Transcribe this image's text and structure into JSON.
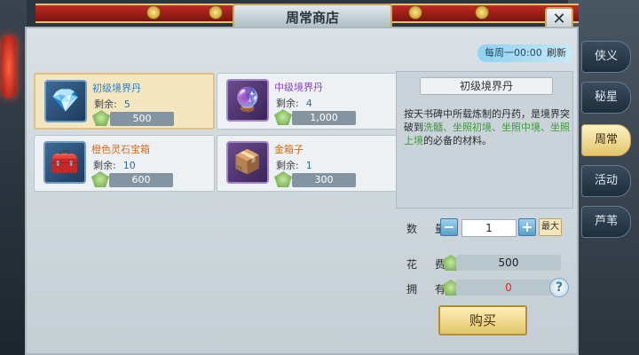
{
  "window": {
    "title": "周常商店",
    "close_symbol": "✕"
  },
  "refresh": {
    "time": "每周一00:00",
    "label": "刷新"
  },
  "items": [
    {
      "name": "初级境界丹",
      "remain_label": "剩余:",
      "remain": "5",
      "price": "500",
      "icon": "pink-pill-icon",
      "selected": true
    },
    {
      "name": "中级境界丹",
      "remain_label": "剩余:",
      "remain": "4",
      "price": "1,000",
      "icon": "purple-pill-icon",
      "selected": false
    },
    {
      "name": "橙色灵石宝箱",
      "remain_label": "剩余:",
      "remain": "10",
      "price": "600",
      "icon": "red-chest-icon",
      "selected": false
    },
    {
      "name": "金箱子",
      "remain_label": "剩余:",
      "remain": "1",
      "price": "300",
      "icon": "gold-chest-icon",
      "selected": false
    }
  ],
  "detail": {
    "title": "初级境界丹",
    "desc_1": "按天书碑中所载炼制的丹药，是境界突破到",
    "desc_green_1": "洗髓、坐照初境、坐照中境、坐照上境",
    "desc_2": "的必备的材料。"
  },
  "purchase": {
    "qty_label": "数 量",
    "minus": "−",
    "qty": "1",
    "plus": "+",
    "max": "最大",
    "cost_label": "花 费",
    "cost": "500",
    "own_label": "拥 有",
    "own": "0",
    "help": "?",
    "buy": "购买"
  },
  "tabs": [
    {
      "label": "侠义",
      "active": false
    },
    {
      "label": "秘星",
      "active": false
    },
    {
      "label": "周常",
      "active": true
    },
    {
      "label": "活动",
      "active": false
    },
    {
      "label": "芦苇",
      "active": false
    }
  ],
  "colors": {
    "selected_card": "#f4e6bf",
    "accent_blue": "#5b9ec9",
    "owned_red": "#e02a18"
  }
}
